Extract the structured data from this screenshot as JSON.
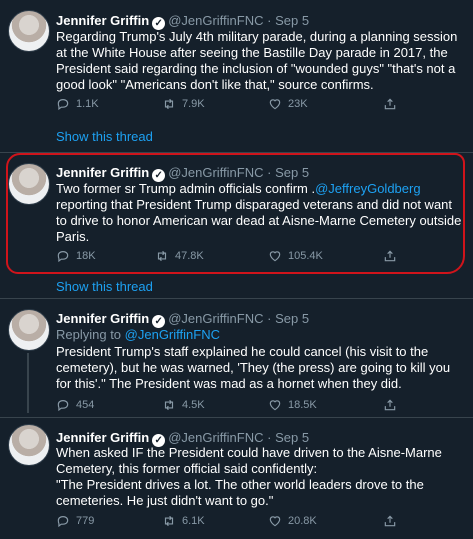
{
  "tweets": [
    {
      "name": "Jennifer Griffin",
      "handle": "@JenGriffinFNC",
      "dot": "·",
      "date": "Sep 5",
      "body": "Regarding Trump's July 4th military parade, during a planning session at the White House after seeing the Bastille Day parade in 2017, the President said regarding the inclusion of \"wounded guys\" \"that's not a good look\" \"Americans don't like that,\" source confirms.",
      "reply_count": "1.1K",
      "retweet_count": "7.9K",
      "like_count": "23K",
      "show_thread": "Show this thread"
    },
    {
      "name": "Jennifer Griffin",
      "handle": "@JenGriffinFNC",
      "dot": "·",
      "date": "Sep 5",
      "body_prefix": "Two former sr Trump admin officials confirm .",
      "mention": "@JeffreyGoldberg",
      "body_suffix": " reporting that President Trump disparaged veterans and did not want to drive to honor American war dead at Aisne-Marne Cemetery outside Paris.",
      "reply_count": "18K",
      "retweet_count": "47.8K",
      "like_count": "105.4K",
      "show_thread": "Show this thread"
    },
    {
      "name": "Jennifer Griffin",
      "handle": "@JenGriffinFNC",
      "dot": "·",
      "date": "Sep 5",
      "replying_label": "Replying to ",
      "replying_to": "@JenGriffinFNC",
      "body": "President Trump's staff explained he could cancel (his visit to the cemetery), but he was warned, 'They (the press) are going to kill you for this'.\" The President was mad as a hornet when they did.",
      "reply_count": "454",
      "retweet_count": "4.5K",
      "like_count": "18.5K"
    },
    {
      "name": "Jennifer Griffin",
      "handle": "@JenGriffinFNC",
      "dot": "·",
      "date": "Sep 5",
      "body": "When asked IF the President could have driven to the Aisne-Marne Cemetery, this former official said confidently:\n\"The President drives a lot. The other world leaders drove to the cemeteries. He just didn't want to go.\"",
      "reply_count": "779",
      "retweet_count": "6.1K",
      "like_count": "20.8K"
    }
  ],
  "icons": {
    "verified": "verified-badge-icon",
    "reply": "reply-icon",
    "retweet": "retweet-icon",
    "like": "heart-icon",
    "share": "share-icon"
  },
  "colors": {
    "background": "#15202b",
    "link": "#1da1f2",
    "muted": "#8899a6",
    "highlight": "#d0141b"
  }
}
